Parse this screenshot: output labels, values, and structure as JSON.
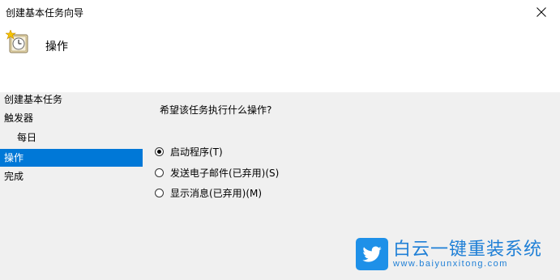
{
  "window": {
    "title": "创建基本任务向导"
  },
  "header": {
    "title": "操作"
  },
  "nav": {
    "items": [
      {
        "label": "创建基本任务",
        "sub": false,
        "selected": false
      },
      {
        "label": "触发器",
        "sub": false,
        "selected": false
      },
      {
        "label": "每日",
        "sub": true,
        "selected": false
      },
      {
        "label": "操作",
        "sub": false,
        "selected": true
      },
      {
        "label": "完成",
        "sub": false,
        "selected": false
      }
    ]
  },
  "main": {
    "question": "希望该任务执行什么操作?",
    "options": [
      {
        "label": "启动程序(T)",
        "checked": true
      },
      {
        "label": "发送电子邮件(已弃用)(S)",
        "checked": false
      },
      {
        "label": "显示消息(已弃用)(M)",
        "checked": false
      }
    ]
  },
  "watermark": {
    "brand": "白云一键重装系统",
    "url": "www.baiyunxitong.com"
  },
  "colors": {
    "selected": "#0078d7",
    "panel": "#f0f0f0",
    "brand": "#1e7fd6"
  }
}
